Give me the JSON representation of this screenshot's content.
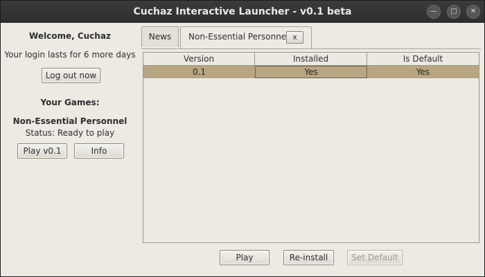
{
  "window": {
    "title": "Cuchaz Interactive Launcher - v0.1 beta"
  },
  "sidebar": {
    "welcome": "Welcome, Cuchaz",
    "login_info": "Your login lasts for 6 more days",
    "logout_label": "Log out now",
    "games_heading": "Your Games:",
    "game_name": "Non-Essential Personnel",
    "game_status": "Status: Ready to play",
    "play_label": "Play v0.1",
    "info_label": "Info"
  },
  "tabs": [
    {
      "label": "News"
    },
    {
      "label": "Non-Essential Personnel",
      "close_label": "x"
    }
  ],
  "table": {
    "columns": [
      "Version",
      "Installed",
      "Is Default"
    ],
    "rows": [
      [
        "0.1",
        "Yes",
        "Yes"
      ]
    ]
  },
  "actions": {
    "play_label": "Play",
    "reinstall_label": "Re-install",
    "set_default_label": "Set Default"
  },
  "colors": {
    "selection": "#b8a683",
    "titlebar": "#2e2e2e",
    "background": "#edeae4"
  },
  "icons": {
    "minimize": "minimize-icon",
    "maximize": "maximize-icon",
    "close": "close-icon"
  }
}
